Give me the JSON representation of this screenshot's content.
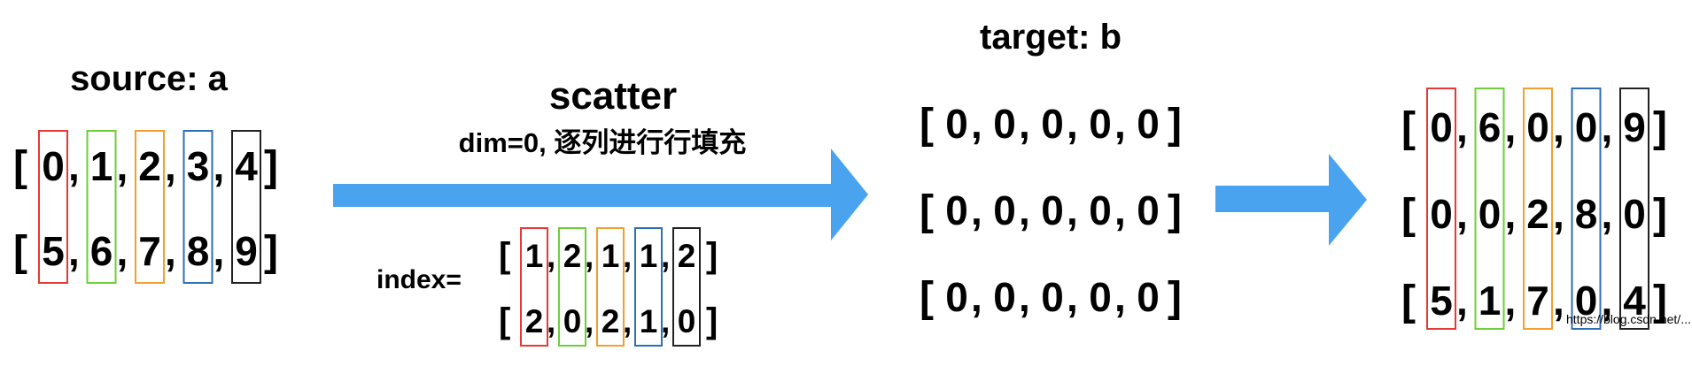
{
  "colors": [
    "#e53935",
    "#6ccf3a",
    "#f0a030",
    "#2f6fb5",
    "#222222"
  ],
  "arrow_color": "#4aa3ee",
  "source": {
    "title": "source: a",
    "rows": [
      [
        "0",
        "1",
        "2",
        "3",
        "4"
      ],
      [
        "5",
        "6",
        "7",
        "8",
        "9"
      ]
    ]
  },
  "operation": {
    "title": "scatter",
    "subtitle": "dim=0, 逐列进行行填充"
  },
  "index": {
    "label": "index=",
    "rows": [
      [
        "1",
        "2",
        "1",
        "1",
        "2"
      ],
      [
        "2",
        "0",
        "2",
        "1",
        "0"
      ]
    ]
  },
  "target": {
    "title": "target: b",
    "rows": [
      [
        "0",
        "0",
        "0",
        "0",
        "0"
      ],
      [
        "0",
        "0",
        "0",
        "0",
        "0"
      ],
      [
        "0",
        "0",
        "0",
        "0",
        "0"
      ]
    ]
  },
  "result": {
    "rows": [
      [
        "0",
        "6",
        "0",
        "0",
        "9"
      ],
      [
        "0",
        "0",
        "2",
        "8",
        "0"
      ],
      [
        "5",
        "1",
        "7",
        "0",
        "4"
      ]
    ]
  },
  "watermark": "https://blog.csdn.net/..."
}
